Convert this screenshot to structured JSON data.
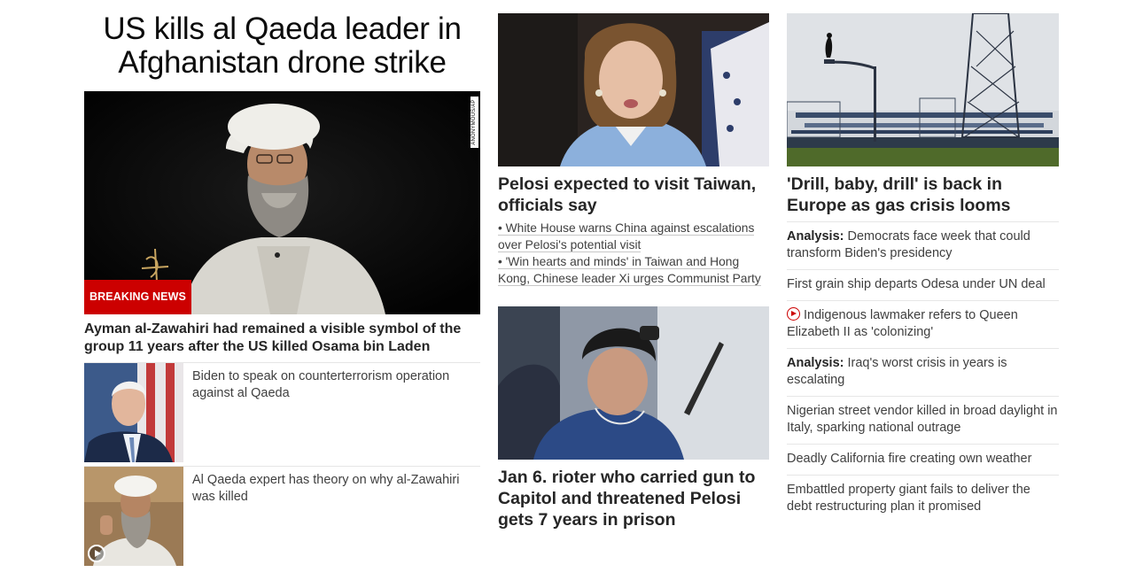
{
  "column1": {
    "headline": "US kills al Qaeda leader in Afghanistan drone strike",
    "hero_badge": "BREAKING NEWS",
    "hero_credit": "ANONYMOUS/AP",
    "lead_summary": "Ayman al-Zawahiri had remained a visible symbol of the group 11 years after the US killed Osama bin Laden",
    "thumb_stories": [
      {
        "text": "Biden to speak on counterterrorism operation against al Qaeda",
        "icon": "photo"
      },
      {
        "text": "Al Qaeda expert has theory on why al-Zawahiri was killed",
        "icon": "play-icon"
      }
    ]
  },
  "column2": {
    "story1": {
      "title": "Pelosi expected to visit Taiwan, officials say",
      "bullets": [
        "• White House warns China against escalations over Pelosi's potential visit",
        "• 'Win hearts and minds' in Taiwan and Hong Kong, Chinese leader Xi urges Communist Party"
      ]
    },
    "story2": {
      "title": "Jan 6. rioter who carried gun to Capitol and threatened Pelosi gets 7 years in prison"
    }
  },
  "column3": {
    "lead_title": "'Drill, baby, drill' is back in Europe as gas crisis looms",
    "items": [
      {
        "label": "Analysis:",
        "text": " Democrats face week that could transform Biden's presidency",
        "video": false
      },
      {
        "label": "",
        "text": "First grain ship departs Odesa under UN deal",
        "video": false
      },
      {
        "label": "",
        "text": "Indigenous lawmaker refers to Queen Elizabeth II as 'colonizing'",
        "video": true
      },
      {
        "label": "Analysis:",
        "text": " Iraq's worst crisis in years is escalating",
        "video": false
      },
      {
        "label": "",
        "text": "Nigerian street vendor killed in broad daylight in Italy, sparking national outrage",
        "video": false
      },
      {
        "label": "",
        "text": "Deadly California fire creating own weather",
        "video": false
      },
      {
        "label": "",
        "text": "Embattled property giant fails to deliver the debt restructuring plan it promised",
        "video": false
      }
    ]
  },
  "colors": {
    "breaking_red": "#cc0000",
    "text_dark": "#262626",
    "text_body": "#404040",
    "rule": "#e6e6e6"
  }
}
